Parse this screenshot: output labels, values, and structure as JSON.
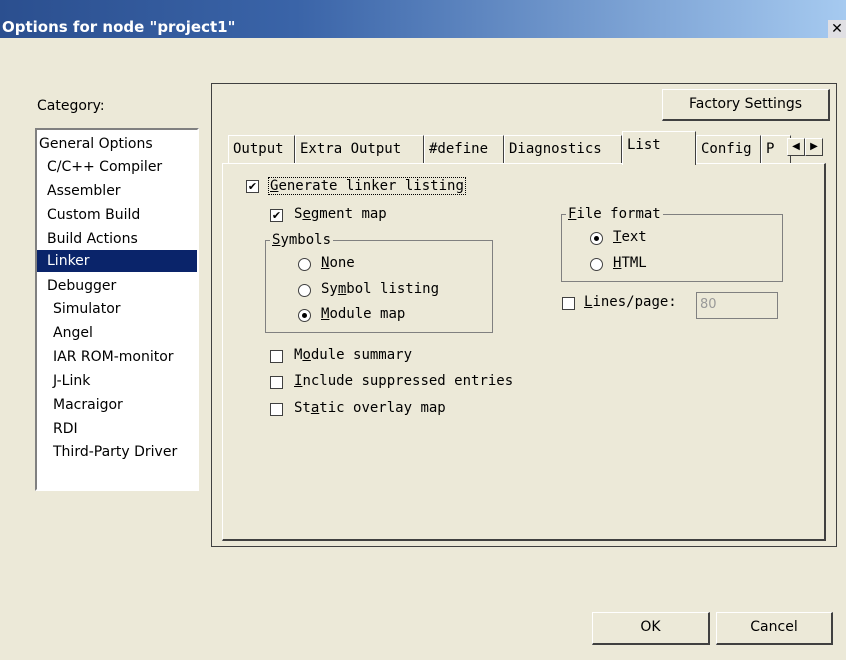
{
  "window": {
    "title": "Options for node \"project1\"",
    "close": "✕"
  },
  "category": {
    "label": "Category:",
    "items": [
      "General Options",
      "C/C++ Compiler",
      "Assembler",
      "Custom Build",
      "Build Actions",
      "Linker",
      "Debugger",
      "Simulator",
      "Angel",
      "IAR ROM-monitor",
      "J-Link",
      "Macraigor",
      "RDI",
      "Third-Party Driver"
    ],
    "selected": "Linker"
  },
  "factory_settings": "Factory Settings",
  "tabs": [
    "Output",
    "Extra Output",
    "#define",
    "Diagnostics",
    "List",
    "Config",
    "P"
  ],
  "active_tab": "List",
  "list": {
    "generate_pre": "",
    "generate_u": "G",
    "generate_post": "enerate linker listing",
    "generate_checked": true,
    "segment_pre": "S",
    "segment_u": "e",
    "segment_post": "gment map",
    "segment_checked": true,
    "symbols_u": "S",
    "symbols_post": "ymbols",
    "none_u": "N",
    "none_post": "one",
    "symbol_listing_pre": "Sy",
    "symbol_listing_u": "m",
    "symbol_listing_post": "bol listing",
    "module_map_u": "M",
    "module_map_post": "odule map",
    "symbols_selected": "Module map",
    "file_format_u": "F",
    "file_format_post": "ile format",
    "text_u": "T",
    "text_post": "ext",
    "html_u": "H",
    "html_post": "TML",
    "file_format_selected": "Text",
    "lines_u": "L",
    "lines_post": "ines/page:",
    "lines_checked": false,
    "lines_value": "80",
    "module_summary_pre": "M",
    "module_summary_u": "o",
    "module_summary_post": "dule summary",
    "module_summary_checked": false,
    "include_u": "I",
    "include_post": "nclude suppressed entries",
    "include_checked": false,
    "static_pre": "St",
    "static_u": "a",
    "static_post": "tic overlay map",
    "static_checked": false
  },
  "buttons": {
    "ok": "OK",
    "cancel": "Cancel"
  }
}
